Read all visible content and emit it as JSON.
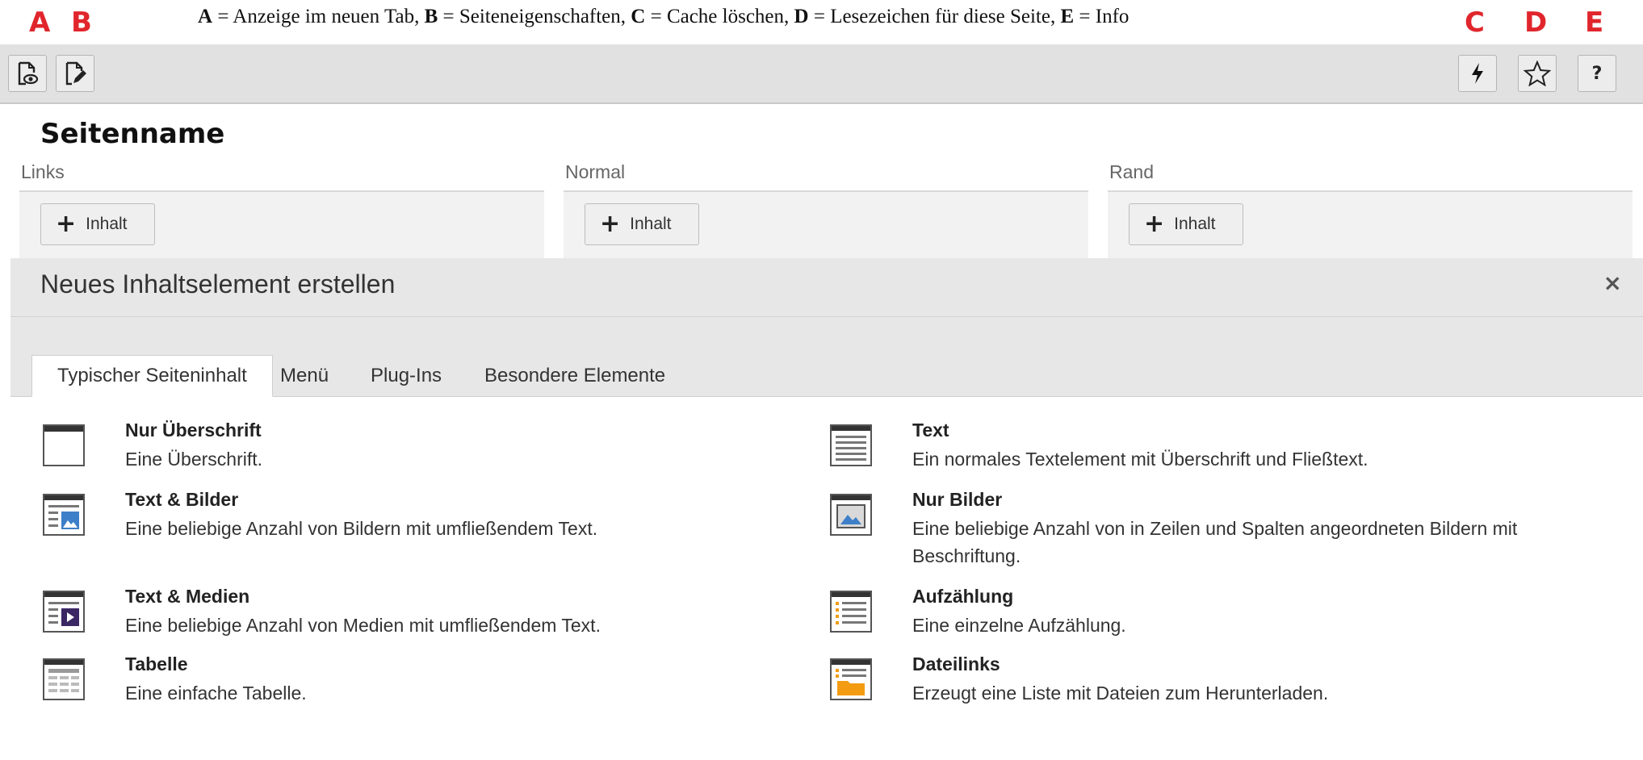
{
  "legend": {
    "letters": [
      "A",
      "B",
      "C",
      "D",
      "E"
    ],
    "text_parts": [
      {
        "key": "A",
        "text": " = Anzeige im neuen Tab, "
      },
      {
        "key": "B",
        "text": " = Seiteneigenschaften, "
      },
      {
        "key": "C",
        "text": " = Cache löschen, "
      },
      {
        "key": "D",
        "text": " = Lesezeichen für diese Seite, "
      },
      {
        "key": "E",
        "text": " = Info"
      }
    ],
    "accent_color": "#e0262c"
  },
  "toolbar": {
    "view_icon": "page-view-icon",
    "edit_icon": "page-edit-icon",
    "cache_icon": "lightning-icon",
    "bookmark_icon": "star-icon",
    "help_label": "?"
  },
  "page": {
    "title": "Seitenname",
    "columns": [
      {
        "label": "Links",
        "button": "Inhalt"
      },
      {
        "label": "Normal",
        "button": "Inhalt"
      },
      {
        "label": "Rand",
        "button": "Inhalt"
      }
    ]
  },
  "modal": {
    "title": "Neues Inhaltselement erstellen",
    "close": "×",
    "tabs": [
      "Typischer Seiteninhalt",
      "Menü",
      "Plug-Ins",
      "Besondere Elemente"
    ],
    "active_tab": "Typischer Seiteninhalt",
    "items": [
      {
        "name": "Nur Überschrift",
        "desc": "Eine Überschrift.",
        "icon": "header-icon"
      },
      {
        "name": "Text",
        "desc": "Ein normales Textelement mit Überschrift und Fließtext.",
        "icon": "text-icon"
      },
      {
        "name": "Text & Bilder",
        "desc": "Eine beliebige Anzahl von Bildern mit umfließendem Text.",
        "icon": "textpic-icon"
      },
      {
        "name": "Nur Bilder",
        "desc": "Eine beliebige Anzahl von in Zeilen und Spalten angeordneten Bildern mit Beschriftung.",
        "icon": "images-icon"
      },
      {
        "name": "Text & Medien",
        "desc": "Eine beliebige Anzahl von Medien mit umfließendem Text.",
        "icon": "textmedia-icon"
      },
      {
        "name": "Aufzählung",
        "desc": "Eine einzelne Aufzählung.",
        "icon": "bullets-icon"
      },
      {
        "name": "Tabelle",
        "desc": "Eine einfache Tabelle.",
        "icon": "table-icon"
      },
      {
        "name": "Dateilinks",
        "desc": "Erzeugt eine Liste mit Dateien zum Herunterladen.",
        "icon": "filelinks-icon"
      }
    ]
  }
}
